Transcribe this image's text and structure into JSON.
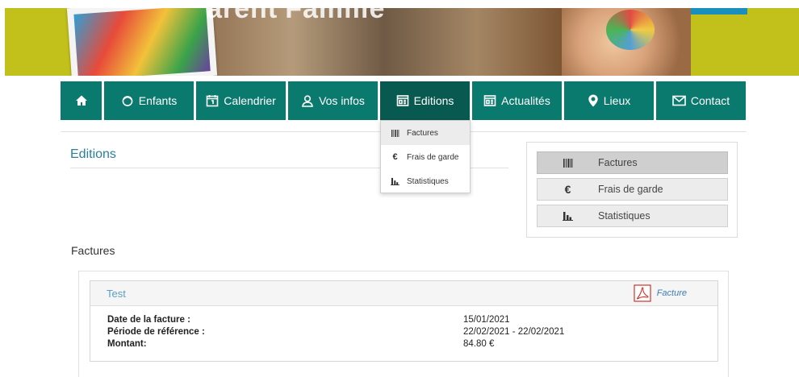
{
  "banner": {
    "title_fragment": "arent'Famille"
  },
  "nav": {
    "items": [
      {
        "label": "",
        "icon": "home-icon"
      },
      {
        "label": "Enfants",
        "icon": "child-icon"
      },
      {
        "label": "Calendrier",
        "icon": "calendar-icon"
      },
      {
        "label": "Vos infos",
        "icon": "user-icon"
      },
      {
        "label": "Editions",
        "icon": "document-icon",
        "active": true
      },
      {
        "label": "Actualités",
        "icon": "news-icon"
      },
      {
        "label": "Lieux",
        "icon": "map-pin-icon"
      },
      {
        "label": "Contact",
        "icon": "envelope-icon"
      }
    ]
  },
  "dropdown": {
    "items": [
      {
        "label": "Factures",
        "icon": "barcode-icon"
      },
      {
        "label": "Frais de garde",
        "icon": "euro-icon"
      },
      {
        "label": "Statistiques",
        "icon": "bar-chart-icon"
      }
    ]
  },
  "page": {
    "title": "Editions"
  },
  "side_menu": {
    "items": [
      {
        "label": "Factures",
        "icon": "barcode-icon",
        "active": true
      },
      {
        "label": "Frais de garde",
        "icon": "euro-icon"
      },
      {
        "label": "Statistiques",
        "icon": "bar-chart-icon"
      }
    ]
  },
  "section": {
    "label": "Factures"
  },
  "invoice": {
    "name": "Test",
    "pdf_label": "Facture",
    "fields": [
      {
        "label": "Date de la facture :",
        "value": "15/01/2021"
      },
      {
        "label": "Période de référence :",
        "value": "22/02/2021 - 22/02/2021"
      },
      {
        "label": "Montant:",
        "value": "84.80 €"
      }
    ]
  },
  "colors": {
    "nav": "#0b7a6e",
    "nav_active": "#08594f",
    "banner": "#c2c01a",
    "title": "#2c7f9a"
  }
}
